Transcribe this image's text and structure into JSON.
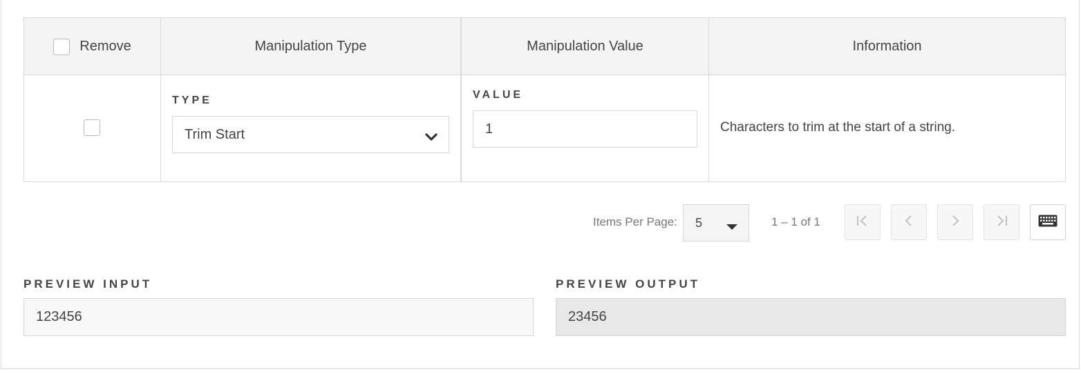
{
  "table": {
    "headers": {
      "remove": "Remove",
      "manipulation_type": "Manipulation Type",
      "manipulation_value": "Manipulation Value",
      "information": "Information"
    },
    "rows": [
      {
        "type_label": "TYPE",
        "type_value": "Trim Start",
        "value_label": "VALUE",
        "value": "1",
        "information": "Characters to trim at the start of a string."
      }
    ]
  },
  "pagination": {
    "items_per_page_label": "Items Per Page:",
    "items_per_page_value": "5",
    "range_text": "1 – 1 of 1",
    "buttons": [
      "first-page-icon",
      "previous-page-icon",
      "next-page-icon",
      "last-page-icon",
      "keyboard-icon"
    ]
  },
  "preview": {
    "input_label": "PREVIEW INPUT",
    "input_value": "123456",
    "output_label": "PREVIEW OUTPUT",
    "output_value": "23456"
  },
  "colors": {
    "header_bg": "#f4f4f4",
    "border": "#dadada",
    "readonly_bg": "#e8e8e8",
    "input_bg": "#f8f8f8"
  }
}
